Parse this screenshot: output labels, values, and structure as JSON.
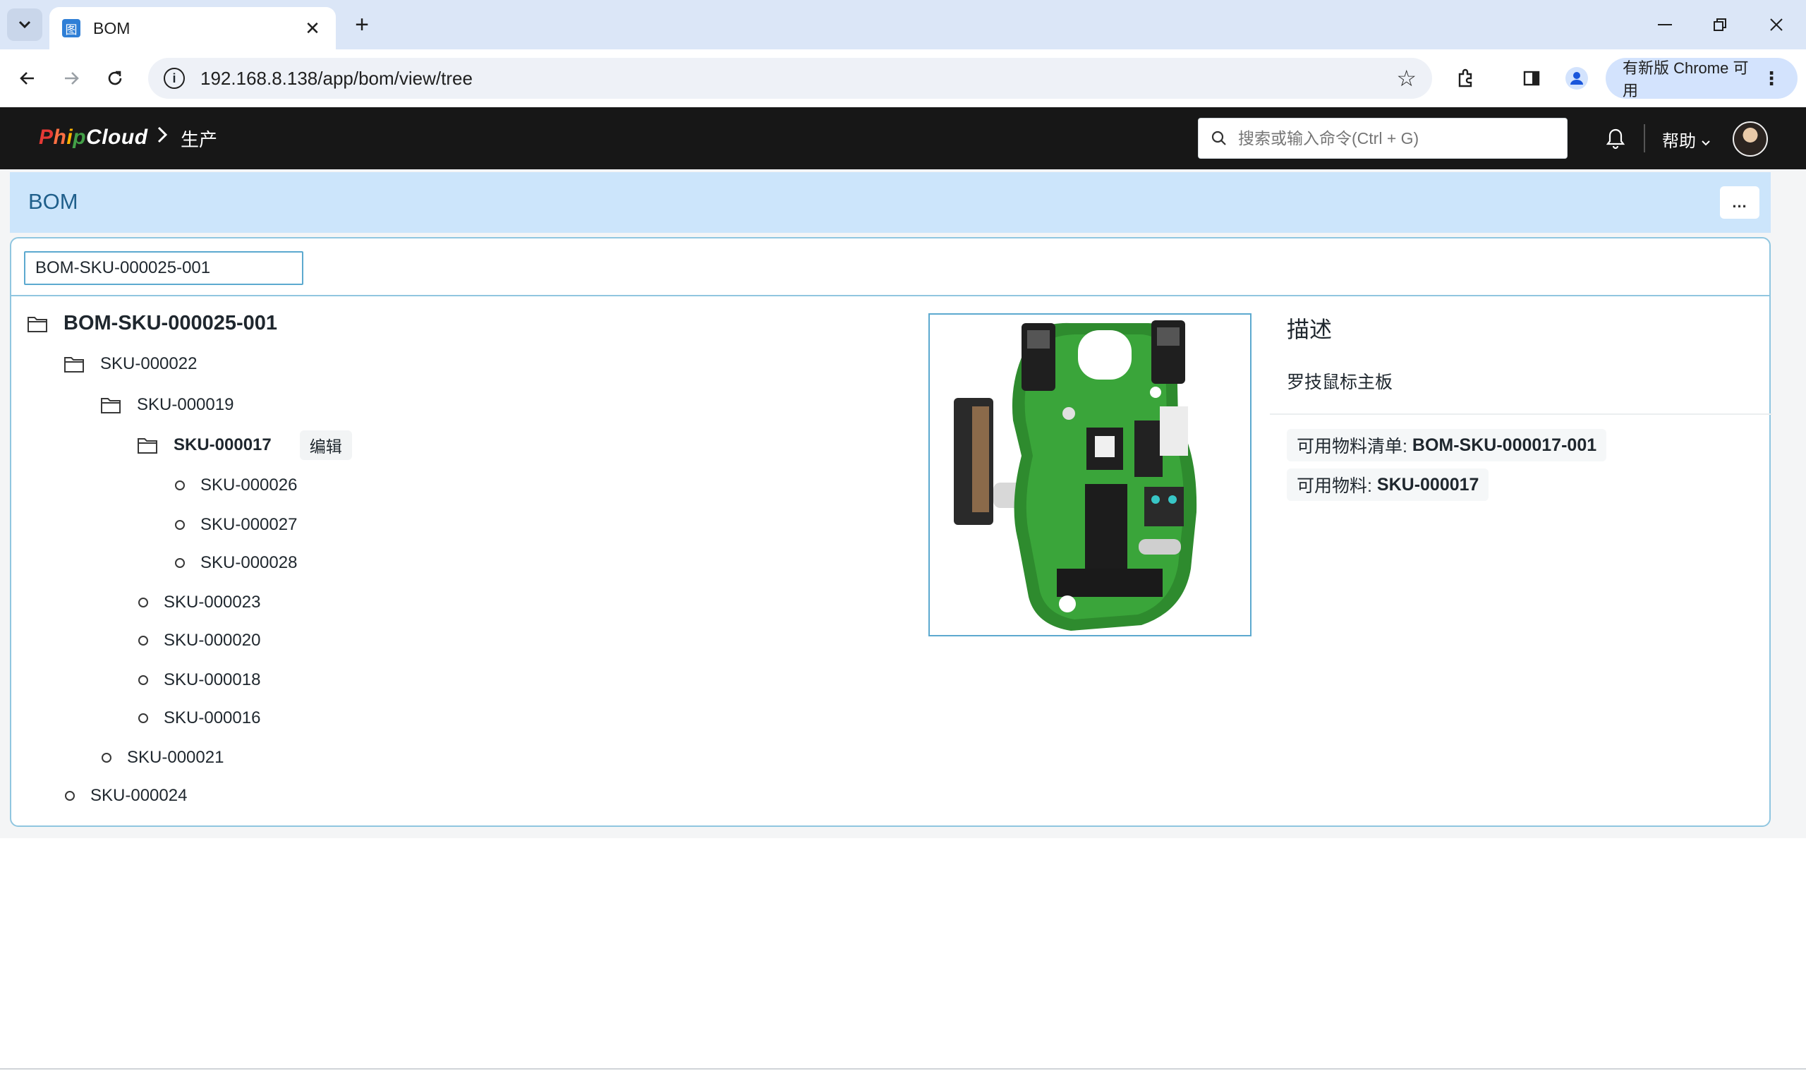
{
  "browser": {
    "tab_title": "BOM",
    "tab_favicon_glyph": "图",
    "new_tab_glyph": "+",
    "url": "192.168.8.138/app/bom/view/tree",
    "chrome_update_label": "有新版 Chrome 可用",
    "icons": [
      "tab-search-icon",
      "back-arrow-icon",
      "forward-arrow-icon",
      "reload-icon",
      "site-info-icon",
      "bookmark-star-icon",
      "extensions-icon",
      "side-panel-icon",
      "profile-icon",
      "more-vert-icon",
      "minimize-icon",
      "maximize-icon",
      "close-icon"
    ]
  },
  "navbar": {
    "logo_text": [
      "P",
      "h",
      "i",
      "p",
      "C",
      "l",
      "o",
      "u",
      "d"
    ],
    "logo_colors": [
      "#e53935",
      "#ff7043",
      "#ffb300",
      "#43a047",
      "#ffffff",
      "#ffffff",
      "#ffffff",
      "#ffffff",
      "#ffffff"
    ],
    "breadcrumb": "生产",
    "search_placeholder": "搜索或输入命令(Ctrl + G)",
    "help_label": "帮助"
  },
  "page": {
    "title": "BOM",
    "menu_label": "..."
  },
  "filter": {
    "value": "BOM-SKU-000025-001"
  },
  "tree": {
    "root": "BOM-SKU-000025-001",
    "nodes": [
      {
        "label": "SKU-000022"
      },
      {
        "label": "SKU-000019"
      },
      {
        "label": "SKU-000017",
        "edit_label": "编辑"
      },
      {
        "label": "SKU-000026"
      },
      {
        "label": "SKU-000027"
      },
      {
        "label": "SKU-000028"
      },
      {
        "label": "SKU-000023"
      },
      {
        "label": "SKU-000020"
      },
      {
        "label": "SKU-000018"
      },
      {
        "label": "SKU-000016"
      },
      {
        "label": "SKU-000021"
      },
      {
        "label": "SKU-000024"
      }
    ]
  },
  "detail": {
    "heading": "描述",
    "description": "罗技鼠标主板",
    "bom_label": "可用物料清单:",
    "bom_value": "BOM-SKU-000017-001",
    "item_label": "可用物料:",
    "item_value": "SKU-000017"
  },
  "colors": {
    "accent": "#5ca9cf",
    "header_bg": "#cce5fb",
    "navbar_bg": "#171717"
  }
}
